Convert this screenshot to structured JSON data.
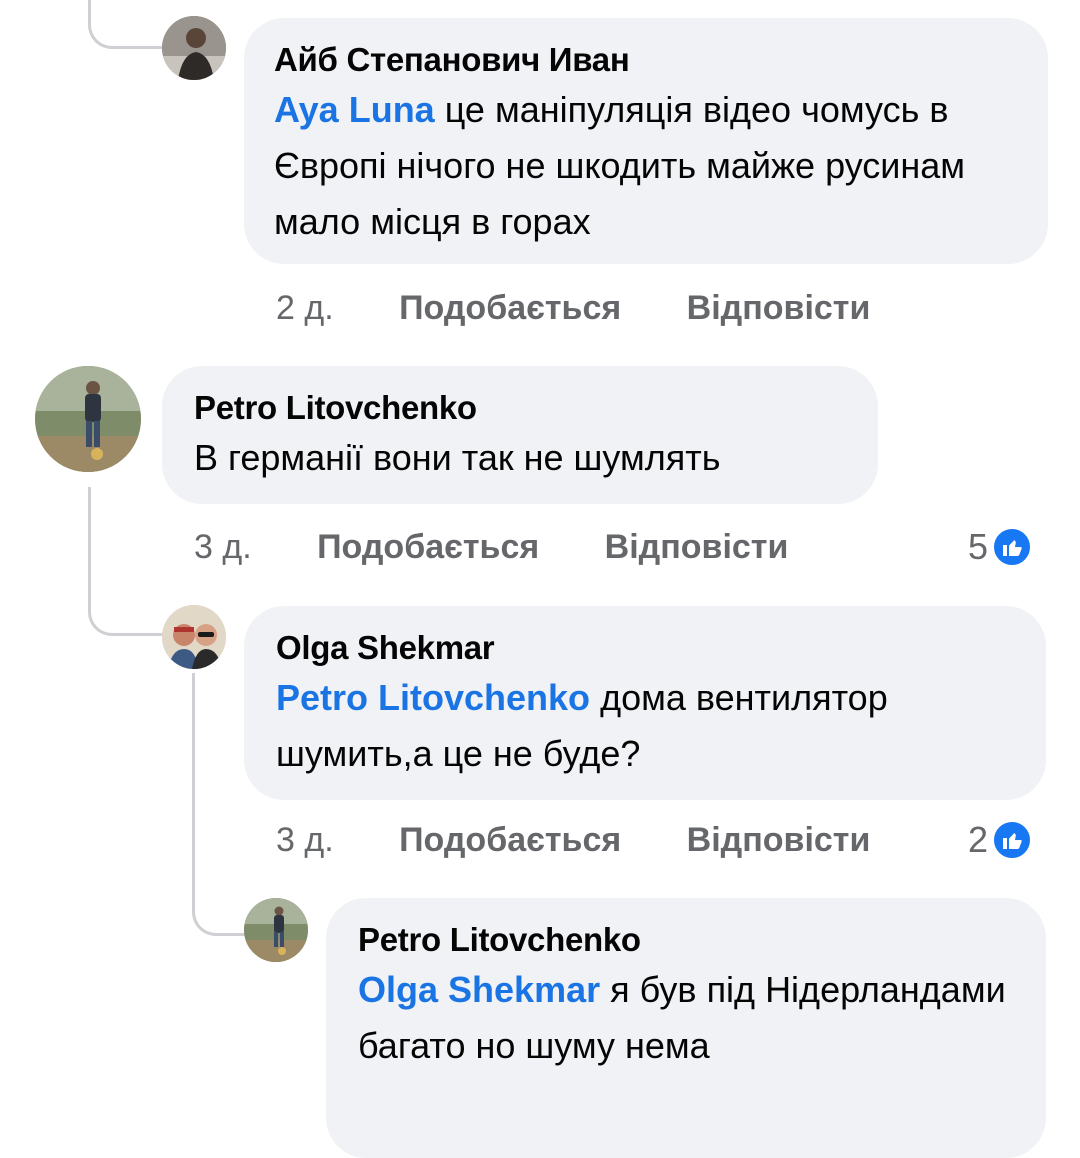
{
  "comments": [
    {
      "author": "Айб Степанович Иван",
      "mention": "Aya Luna",
      "text": " це маніпуляція відео чомусь в Європі нічого не шкодить майже русинам мало місця в горах",
      "time": "2 д.",
      "like_label": "Подобається",
      "reply_label": "Відповісти"
    },
    {
      "author": "Petro Litovchenko",
      "mention": "",
      "text": "В германії вони так не шумлять",
      "time": "3 д.",
      "like_label": "Подобається",
      "reply_label": "Відповісти",
      "reactions": "5"
    },
    {
      "author": "Olga Shekmar",
      "mention": "Petro Litovchenko",
      "text": " дома вентилятор шумить,а це не буде?",
      "time": "3 д.",
      "like_label": "Подобається",
      "reply_label": "Відповісти",
      "reactions": "2"
    },
    {
      "author": "Petro Litovchenko",
      "mention": "Olga Shekmar",
      "text": " я був під Нідерландами  багато но шуму нема"
    }
  ],
  "colors": {
    "bubble": "#f0f2f5",
    "mention": "#1b74e4",
    "meta": "#65676b",
    "like": "#1877f2",
    "thread_line": "#ced0d4"
  },
  "icons": [
    "like-reaction-icon",
    "avatar-photo"
  ]
}
